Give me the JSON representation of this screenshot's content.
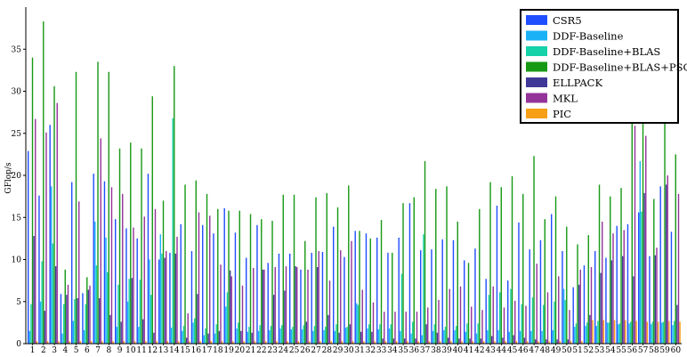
{
  "chart_data": {
    "type": "bar",
    "ylabel": "GFlop/s",
    "xlabel": "",
    "ylim": [
      0,
      40
    ],
    "yticks": [
      0,
      5,
      10,
      15,
      20,
      25,
      30,
      35
    ],
    "grid": false,
    "legend_position": "top-right",
    "categories": [
      "1",
      "2",
      "3",
      "4",
      "5",
      "6",
      "7",
      "8",
      "9",
      "10",
      "11",
      "12",
      "13",
      "14",
      "15",
      "16",
      "17",
      "18",
      "19",
      "20",
      "21",
      "22",
      "23",
      "24",
      "25",
      "26",
      "27",
      "28",
      "29",
      "30",
      "31",
      "32",
      "33",
      "34",
      "35",
      "36",
      "37",
      "38",
      "39",
      "40",
      "41",
      "42",
      "43",
      "44",
      "45",
      "46",
      "47",
      "48",
      "49",
      "50",
      "51",
      "52",
      "53",
      "54",
      "55",
      "56",
      "57",
      "58",
      "59",
      "60"
    ],
    "series": [
      {
        "name": "CSR5",
        "color": "#1f4fff",
        "values": [
          22.9,
          17.6,
          26.0,
          5.9,
          19.2,
          6.0,
          20.2,
          19.3,
          14.8,
          13.7,
          12.5,
          20.2,
          10.0,
          10.8,
          14.2,
          11.0,
          14.1,
          13.1,
          16.1,
          13.2,
          10.2,
          14.1,
          9.6,
          10.7,
          10.7,
          8.8,
          10.8,
          10.9,
          13.9,
          10.3,
          13.4,
          13.1,
          12.6,
          10.8,
          12.6,
          16.7,
          11.1,
          11.2,
          12.4,
          12.3,
          9.9,
          11.3,
          7.7,
          16.4,
          7.5,
          14.4,
          11.2,
          12.3,
          15.4,
          11.0,
          6.7,
          9.3,
          11.0,
          10.2,
          14.0,
          14.2,
          15.6,
          10.4,
          18.7,
          13.3
        ]
      },
      {
        "name": "DDF-Baseline",
        "color": "#1ab2f5",
        "values": [
          1.5,
          5.0,
          18.7,
          1.2,
          2.7,
          1.6,
          14.5,
          12.6,
          2.0,
          5.0,
          2.0,
          10.0,
          13.0,
          1.9,
          1.5,
          2.5,
          1.0,
          1.2,
          4.4,
          1.8,
          1.4,
          1.5,
          1.6,
          1.8,
          1.7,
          1.7,
          1.5,
          1.6,
          1.5,
          1.9,
          4.8,
          1.8,
          1.7,
          1.8,
          1.5,
          1.2,
          1.0,
          1.5,
          1.6,
          1.6,
          1.4,
          1.2,
          1.6,
          1.6,
          1.4,
          1.5,
          1.5,
          1.5,
          1.6,
          6.5,
          2.0,
          2.1,
          2.1,
          2.5,
          2.3,
          2.4,
          21.7,
          2.3,
          2.5,
          2.2
        ]
      },
      {
        "name": "DDF-Baseline+BLAS",
        "color": "#16d2a8",
        "values": [
          4.7,
          9.8,
          11.9,
          4.7,
          5.3,
          4.7,
          9.3,
          8.5,
          7.0,
          7.7,
          7.6,
          5.8,
          10.7,
          26.8,
          2.1,
          3.0,
          1.8,
          2.3,
          6.1,
          2.5,
          2.0,
          2.2,
          2.1,
          2.2,
          2.0,
          2.2,
          2.1,
          2.0,
          2.3,
          2.0,
          4.6,
          2.3,
          2.3,
          2.3,
          8.3,
          2.6,
          13.0,
          2.3,
          2.0,
          2.1,
          2.4,
          2.4,
          5.8,
          6.1,
          6.5,
          4.7,
          5.5,
          4.6,
          5.0,
          5.2,
          2.4,
          2.5,
          2.7,
          2.5,
          2.4,
          2.6,
          15.7,
          2.6,
          2.6,
          2.7
        ]
      },
      {
        "name": "DDF-Baseline+BLAS+PSC",
        "color": "#179914",
        "values": [
          34.0,
          38.3,
          30.6,
          8.8,
          32.3,
          7.9,
          33.5,
          32.3,
          23.2,
          23.9,
          23.2,
          29.4,
          17.0,
          33.0,
          18.9,
          19.4,
          17.8,
          16.0,
          15.8,
          15.8,
          15.4,
          14.8,
          14.6,
          17.7,
          17.7,
          12.2,
          17.4,
          17.9,
          16.2,
          18.8,
          13.4,
          12.5,
          14.7,
          10.8,
          16.7,
          17.4,
          21.7,
          18.4,
          18.7,
          14.5,
          9.6,
          16.0,
          19.2,
          18.6,
          19.9,
          17.8,
          22.3,
          14.8,
          17.5,
          13.9,
          11.8,
          12.9,
          18.9,
          17.5,
          18.5,
          32.0,
          31.4,
          17.2,
          34.0,
          22.5
        ]
      },
      {
        "name": "ELLPACK",
        "color": "#403896",
        "values": [
          12.8,
          3.9,
          9.2,
          5.8,
          5.4,
          6.4,
          5.4,
          3.4,
          2.6,
          7.8,
          2.9,
          1.3,
          10.2,
          10.7,
          0.7,
          5.9,
          1.2,
          1.5,
          8.7,
          1.5,
          1.3,
          8.8,
          5.8,
          6.3,
          9.2,
          2.6,
          9.1,
          3.4,
          1.3,
          2.3,
          1.4,
          1.4,
          0.6,
          0.6,
          0.6,
          0.6,
          2.3,
          1.3,
          0.7,
          0.6,
          0.6,
          0.6,
          0.9,
          0.7,
          1.0,
          0.7,
          0.5,
          0.5,
          0.5,
          0.5,
          7.0,
          3.4,
          8.4,
          9.9,
          10.4,
          8.0,
          17.9,
          10.5,
          18.9,
          4.6
        ]
      },
      {
        "name": "MKL",
        "color": "#94339a",
        "values": [
          26.7,
          25.1,
          28.6,
          7.0,
          16.9,
          6.9,
          24.4,
          18.6,
          17.8,
          13.8,
          15.1,
          16.0,
          11.0,
          12.7,
          3.6,
          15.6,
          15.2,
          9.4,
          8.0,
          6.9,
          9.0,
          8.8,
          9.1,
          9.2,
          9.1,
          8.8,
          11.0,
          7.5,
          11.1,
          12.2,
          6.4,
          4.9,
          3.8,
          3.8,
          3.8,
          3.8,
          4.3,
          5.2,
          6.5,
          6.8,
          4.4,
          4.0,
          6.8,
          4.3,
          5.1,
          4.5,
          9.5,
          6.1,
          8.0,
          4.0,
          8.8,
          9.1,
          14.5,
          13.1,
          13.5,
          25.9,
          24.7,
          11.4,
          20.0,
          17.8
        ]
      },
      {
        "name": "PIC",
        "color": "#f79f15",
        "values": [
          0.3,
          0.3,
          0.3,
          0.3,
          0.3,
          0.3,
          0.3,
          0.3,
          0.3,
          0.3,
          0.3,
          0.3,
          0.3,
          0.3,
          0.3,
          0.3,
          0.3,
          0.3,
          0.3,
          0.3,
          0.3,
          0.3,
          0.3,
          0.3,
          0.3,
          0.3,
          0.3,
          0.3,
          0.3,
          0.3,
          0.3,
          0.3,
          0.3,
          0.3,
          0.3,
          0.3,
          0.3,
          0.3,
          0.3,
          0.3,
          0.3,
          0.3,
          0.3,
          0.3,
          0.3,
          0.3,
          0.3,
          0.3,
          0.3,
          0.3,
          0.3,
          2.8,
          2.8,
          2.8,
          2.8,
          2.7,
          2.6,
          2.6,
          2.7,
          2.6
        ]
      }
    ]
  }
}
